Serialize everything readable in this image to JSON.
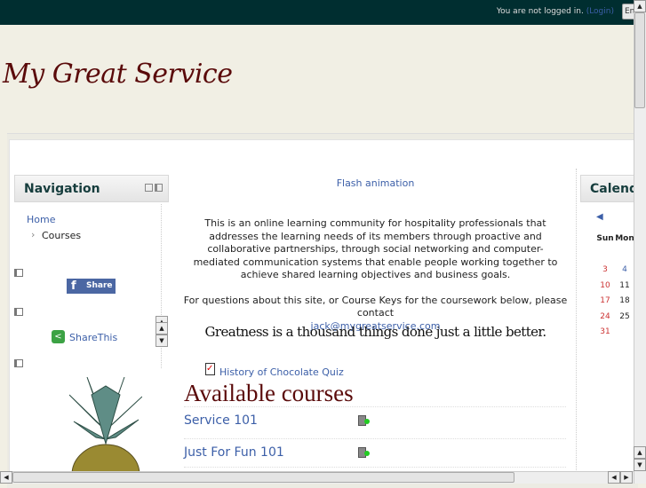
{
  "topbar": {
    "login_text": "You are not logged in.",
    "login_link": "(Login)",
    "language": "En"
  },
  "header": {
    "site_title": "My Great Service"
  },
  "navigation": {
    "title": "Navigation",
    "home": "Home",
    "courses": "Courses"
  },
  "share": {
    "facebook_label": "Share",
    "sharethis_label": "ShareThis"
  },
  "main": {
    "flash": "Flash animation",
    "intro": "This is an online learning community for hospitality professionals that addresses the learning needs of its members through proactive and collaborative partnerships, through social networking and computer-mediated communication systems that enable people working together to achieve shared learning objectives and business goals.",
    "contact": "For questions about this site, or Course Keys for the coursework below, please contact",
    "email": "jack@mygreatservice.com",
    "quote": "Greatness is a thousand things done just a little better.",
    "quiz": "History of Chocolate Quiz",
    "available_title": "Available courses",
    "courses": [
      "Service 101",
      "Just For Fun 101"
    ]
  },
  "calendar": {
    "title": "Calendar",
    "days": [
      "Sun",
      "Mon"
    ],
    "rows": [
      [
        "3",
        "4"
      ],
      [
        "10",
        "11"
      ],
      [
        "17",
        "18"
      ],
      [
        "24",
        "25"
      ],
      [
        "31",
        ""
      ]
    ]
  }
}
